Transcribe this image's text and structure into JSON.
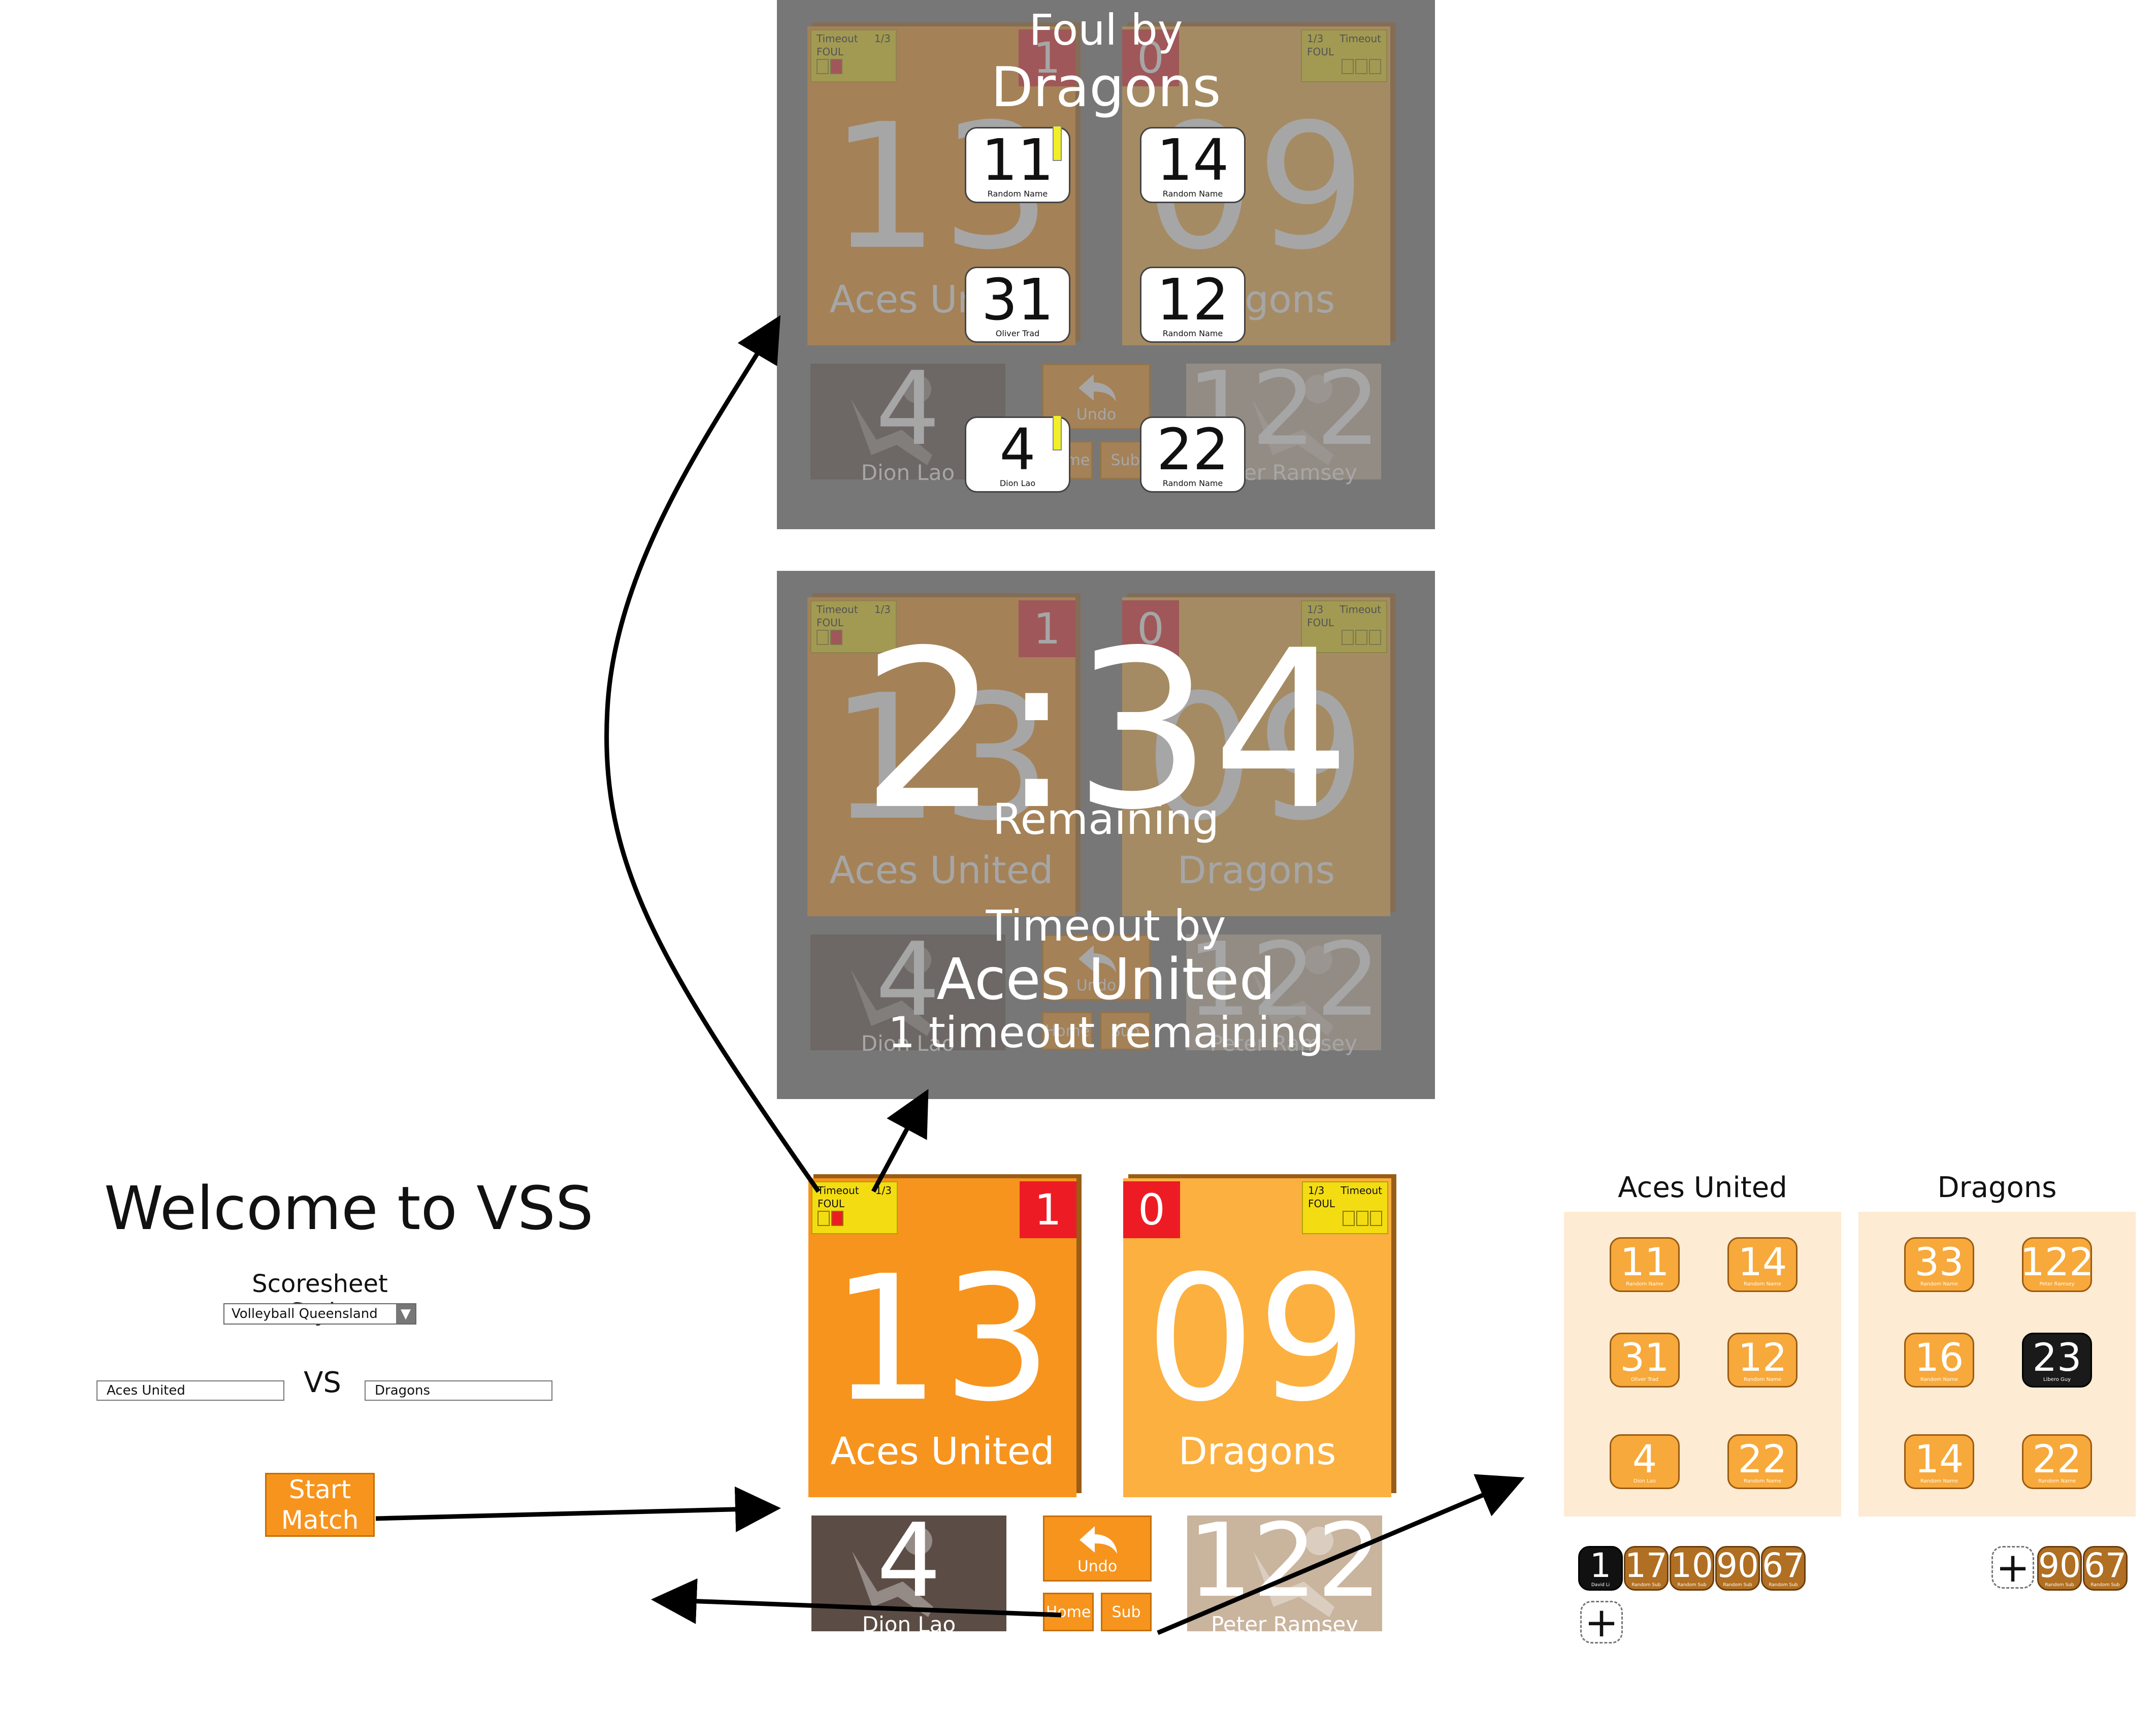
{
  "welcome": {
    "title": "Welcome to VSS",
    "style_label": "Scoresheet Style",
    "style_value": "Volleyball Queensland",
    "team_a": "Aces United",
    "vs": "VS",
    "team_b": "Dragons",
    "start_button": "Start Match"
  },
  "scoreboard": {
    "home": {
      "name": "Aces United",
      "score": "13",
      "sets": "1",
      "timeout_label": "Timeout",
      "timeout_count": "1/3",
      "foul_label": "FOUL"
    },
    "away": {
      "name": "Dragons",
      "score": "09",
      "sets": "0",
      "timeout_label": "Timeout",
      "timeout_count": "1/3",
      "foul_label": "FOUL"
    },
    "home_server": {
      "number": "4",
      "name": "Dion Lao"
    },
    "away_server": {
      "number": "122",
      "name": "Peter Ramsey"
    },
    "undo_label": "Undo",
    "home_label": "Home",
    "sub_label": "Sub"
  },
  "foul_overlay": {
    "line1": "Foul by",
    "team": "Dragons",
    "undo_label": "Undo",
    "players": [
      {
        "number": "11",
        "name": "Random Name",
        "card": true
      },
      {
        "number": "14",
        "name": "Random Name",
        "card": false
      },
      {
        "number": "31",
        "name": "Oliver Trad",
        "card": false
      },
      {
        "number": "12",
        "name": "Random Name",
        "card": false
      },
      {
        "number": "4",
        "name": "Dion Lao",
        "card": true
      },
      {
        "number": "22",
        "name": "Random Name",
        "card": false
      }
    ]
  },
  "timeout_overlay": {
    "time": "2:34",
    "remaining": "Remaining",
    "timeout_by": "Timeout by",
    "team": "Aces United",
    "timeouts_left": "1 timeout remaining"
  },
  "sub_panels": {
    "home": {
      "title": "Aces United",
      "players": [
        {
          "number": "11",
          "name": "Random Name",
          "libero": false
        },
        {
          "number": "14",
          "name": "Random Name",
          "libero": false
        },
        {
          "number": "31",
          "name": "Oliver Trad",
          "libero": false
        },
        {
          "number": "12",
          "name": "Random Name",
          "libero": false
        },
        {
          "number": "4",
          "name": "Dion Lao",
          "libero": false
        },
        {
          "number": "22",
          "name": "Random Name",
          "libero": false
        }
      ],
      "bench": [
        {
          "number": "1",
          "name": "David Li",
          "libero": true
        },
        {
          "number": "17",
          "name": "Random Sub",
          "libero": false
        },
        {
          "number": "10",
          "name": "Random Sub",
          "libero": false
        },
        {
          "number": "90",
          "name": "Random Sub",
          "libero": false
        },
        {
          "number": "67",
          "name": "Random Sub",
          "libero": false
        }
      ],
      "add": "+"
    },
    "away": {
      "title": "Dragons",
      "players": [
        {
          "number": "33",
          "name": "Random Name",
          "libero": false
        },
        {
          "number": "122",
          "name": "Peter Ramsey",
          "libero": false
        },
        {
          "number": "16",
          "name": "Random Name",
          "libero": false
        },
        {
          "number": "23",
          "name": "Libero Guy",
          "libero": true
        },
        {
          "number": "14",
          "name": "Random Name",
          "libero": false
        },
        {
          "number": "22",
          "name": "Random Name",
          "libero": false
        }
      ],
      "bench": [
        {
          "number": "90",
          "name": "Random Sub",
          "libero": false
        },
        {
          "number": "67",
          "name": "Random Sub",
          "libero": false
        }
      ],
      "add": "+"
    }
  },
  "colors": {
    "orange": "#f7941d",
    "light_orange": "#fbb040",
    "red": "#ed1c24",
    "yellow": "#f3dd12",
    "overlay_grey": "#777777",
    "panel_bg": "#fdebd3",
    "server_dark": "#5b4d45",
    "server_light": "#c9b49e"
  },
  "icons": {
    "undo": "undo-arrow-icon",
    "server": "volleyball-player-icon",
    "dropdown": "triangle-down-icon",
    "add": "plus-icon"
  }
}
